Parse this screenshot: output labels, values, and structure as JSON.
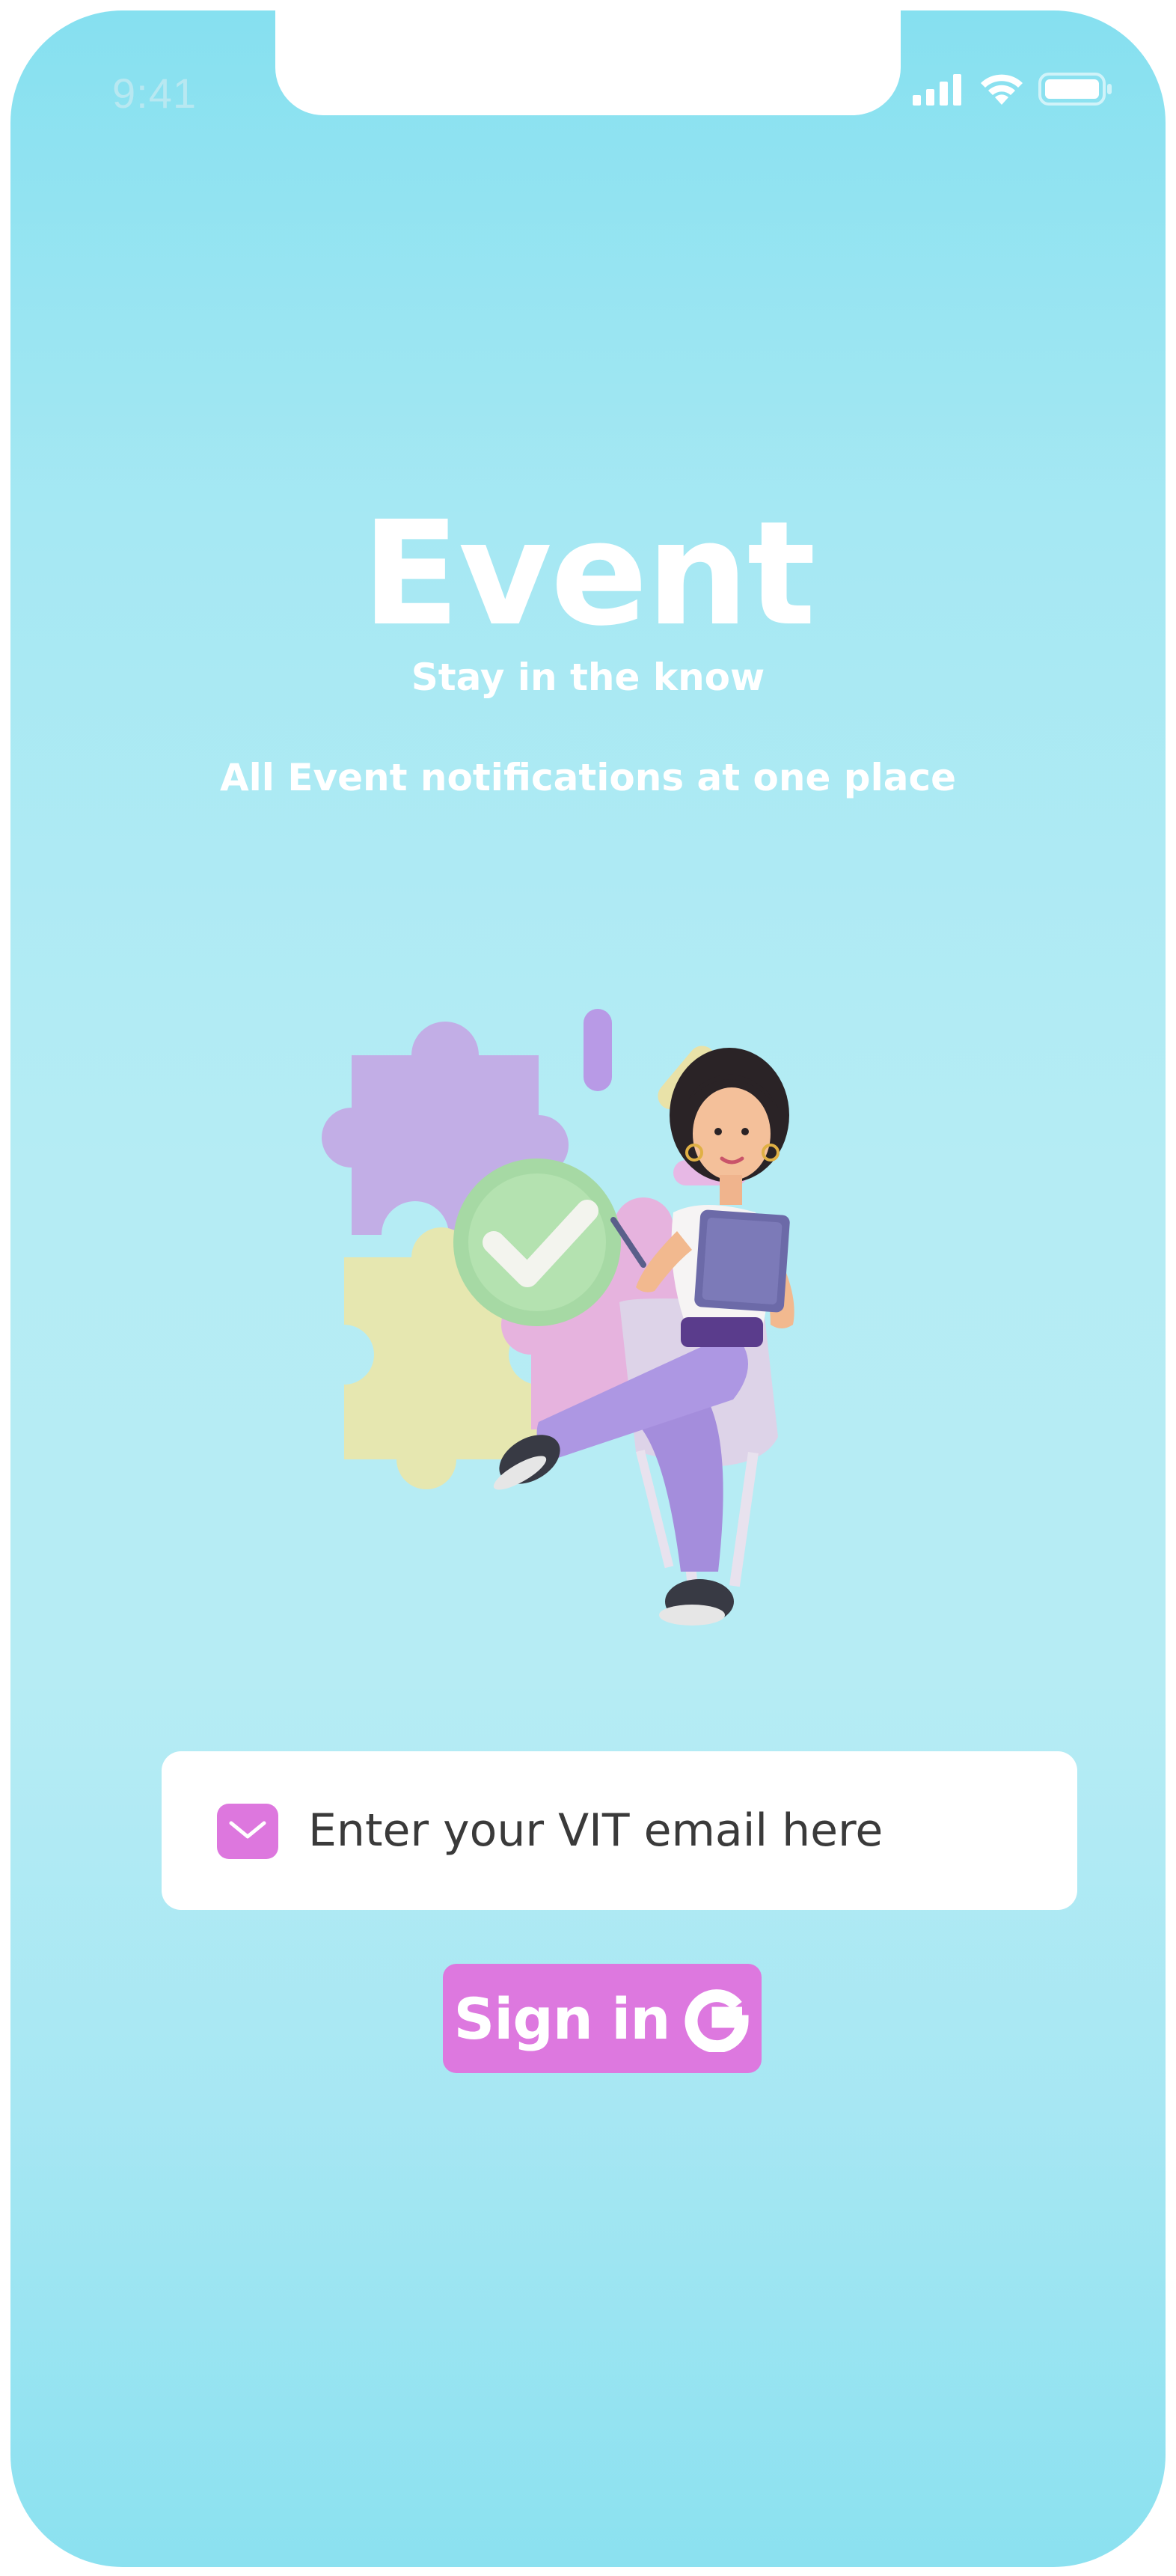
{
  "status_bar": {
    "time": "9:41",
    "icons": [
      "cellular-signal-icon",
      "wifi-icon",
      "battery-icon"
    ]
  },
  "header": {
    "title": "Event",
    "subtitle": "Stay in the know",
    "tagline": "All Event notifications at one place"
  },
  "illustration": {
    "description_icon": "woman-with-tablet-and-puzzle-illustration"
  },
  "email": {
    "icon": "mail-icon",
    "placeholder": "Enter your VIT email here",
    "value": ""
  },
  "signin": {
    "label": "Sign in",
    "icon": "google-icon"
  },
  "colors": {
    "background_top": "#86e0f0",
    "background_mid": "#b6ecf4",
    "accent": "#dd78df",
    "text_light": "#ffffff",
    "input_text": "#3a3a3a"
  }
}
